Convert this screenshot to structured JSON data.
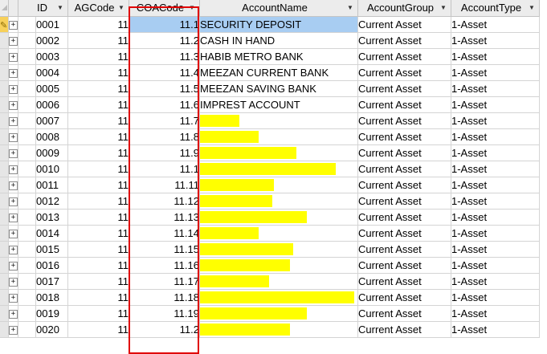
{
  "columns": [
    {
      "key": "id",
      "label": "ID"
    },
    {
      "key": "agcode",
      "label": "AGCode"
    },
    {
      "key": "coacode",
      "label": "COACode"
    },
    {
      "key": "accountname",
      "label": "AccountName"
    },
    {
      "key": "accountgroup",
      "label": "AccountGroup"
    },
    {
      "key": "accounttype",
      "label": "AccountType"
    }
  ],
  "icons": {
    "select_all": "select-all-corner-icon",
    "dropdown": "chevron-down-icon",
    "expand": "expand-plus-icon",
    "edit": "pencil-edit-icon"
  },
  "colors": {
    "highlight": "#a8cdf2",
    "redaction": "#ffff00",
    "frame": "#e00000"
  },
  "rows": [
    {
      "id": "0001",
      "agcode": "11",
      "coacode": "11.1",
      "name": "SECURITY DEPOSIT",
      "group": "Current Asset",
      "type": "1-Asset",
      "redacted": false
    },
    {
      "id": "0002",
      "agcode": "11",
      "coacode": "11.2",
      "name": "CASH IN HAND",
      "group": "Current Asset",
      "type": "1-Asset",
      "redacted": false
    },
    {
      "id": "0003",
      "agcode": "11",
      "coacode": "11.3",
      "name": "HABIB METRO BANK",
      "group": "Current Asset",
      "type": "1-Asset",
      "redacted": false
    },
    {
      "id": "0004",
      "agcode": "11",
      "coacode": "11.4",
      "name": "MEEZAN CURRENT BANK",
      "group": "Current Asset",
      "type": "1-Asset",
      "redacted": false
    },
    {
      "id": "0005",
      "agcode": "11",
      "coacode": "11.5",
      "name": "MEEZAN SAVING BANK",
      "group": "Current Asset",
      "type": "1-Asset",
      "redacted": false
    },
    {
      "id": "0006",
      "agcode": "11",
      "coacode": "11.6",
      "name": "IMPREST ACCOUNT",
      "group": "Current Asset",
      "type": "1-Asset",
      "redacted": false
    },
    {
      "id": "0007",
      "agcode": "11",
      "coacode": "11.7",
      "name": "",
      "group": "Current Asset",
      "type": "1-Asset",
      "redacted": true,
      "redaction_fraction": 0.25
    },
    {
      "id": "0008",
      "agcode": "11",
      "coacode": "11.8",
      "name": "",
      "group": "Current Asset",
      "type": "1-Asset",
      "redacted": true,
      "redaction_fraction": 0.37
    },
    {
      "id": "0009",
      "agcode": "11",
      "coacode": "11.9",
      "name": "",
      "group": "Current Asset",
      "type": "1-Asset",
      "redacted": true,
      "redaction_fraction": 0.61
    },
    {
      "id": "0010",
      "agcode": "11",
      "coacode": "11.1",
      "name": "",
      "group": "Current Asset",
      "type": "1-Asset",
      "redacted": true,
      "redaction_fraction": 0.86
    },
    {
      "id": "0011",
      "agcode": "11",
      "coacode": "11.11",
      "name": "",
      "group": "Current Asset",
      "type": "1-Asset",
      "redacted": true,
      "redaction_fraction": 0.47
    },
    {
      "id": "0012",
      "agcode": "11",
      "coacode": "11.12",
      "name": "",
      "group": "Current Asset",
      "type": "1-Asset",
      "redacted": true,
      "redaction_fraction": 0.46
    },
    {
      "id": "0013",
      "agcode": "11",
      "coacode": "11.13",
      "name": "",
      "group": "Current Asset",
      "type": "1-Asset",
      "redacted": true,
      "redaction_fraction": 0.68
    },
    {
      "id": "0014",
      "agcode": "11",
      "coacode": "11.14",
      "name": "",
      "group": "Current Asset",
      "type": "1-Asset",
      "redacted": true,
      "redaction_fraction": 0.37
    },
    {
      "id": "0015",
      "agcode": "11",
      "coacode": "11.15",
      "name": "",
      "group": "Current Asset",
      "type": "1-Asset",
      "redacted": true,
      "redaction_fraction": 0.59
    },
    {
      "id": "0016",
      "agcode": "11",
      "coacode": "11.16",
      "name": "",
      "group": "Current Asset",
      "type": "1-Asset",
      "redacted": true,
      "redaction_fraction": 0.57
    },
    {
      "id": "0017",
      "agcode": "11",
      "coacode": "11.17",
      "name": "",
      "group": "Current Asset",
      "type": "1-Asset",
      "redacted": true,
      "redaction_fraction": 0.44
    },
    {
      "id": "0018",
      "agcode": "11",
      "coacode": "11.18",
      "name": "",
      "group": "Current Asset",
      "type": "1-Asset",
      "redacted": true,
      "redaction_fraction": 0.98
    },
    {
      "id": "0019",
      "agcode": "11",
      "coacode": "11.19",
      "name": "",
      "group": "Current Asset",
      "type": "1-Asset",
      "redacted": true,
      "redaction_fraction": 0.68
    },
    {
      "id": "0020",
      "agcode": "11",
      "coacode": "11.2",
      "name": "",
      "group": "Current Asset",
      "type": "1-Asset",
      "redacted": true,
      "redaction_fraction": 0.57
    }
  ]
}
